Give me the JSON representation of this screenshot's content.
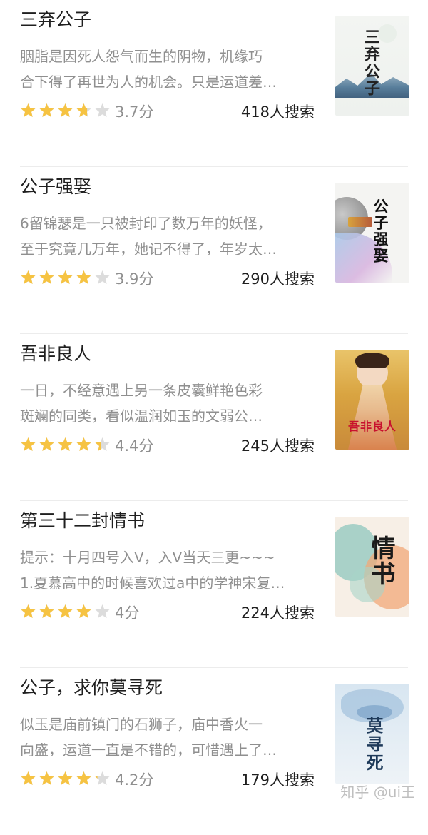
{
  "star_color": "#f6c342",
  "star_empty_color": "#dcdcdc",
  "books": [
    {
      "title": "三弃公子",
      "desc_line1": "胭脂是因死人怨气而生的阴物，机缘巧",
      "desc_line2": "合下得了再世为人的机会。只是运道差…",
      "rating": 3.7,
      "score_text": "3.7分",
      "search_text": "418人搜索",
      "cover_title": "三弃公子",
      "cover_icon": "book-cover-ink-mountains"
    },
    {
      "title": "公子强娶",
      "desc_line1": "6留锦瑟是一只被封印了数万年的妖怪，",
      "desc_line2": "至于究竟几万年，她记不得了，年岁太…",
      "rating": 3.9,
      "score_text": "3.9分",
      "search_text": "290人搜索",
      "cover_title": "公子强娶",
      "cover_icon": "book-cover-moon-waves"
    },
    {
      "title": "吾非良人",
      "desc_line1": "一日，不经意遇上另一条皮囊鲜艳色彩",
      "desc_line2": "斑斓的同类，看似温润如玉的文弱公…",
      "rating": 4.4,
      "score_text": "4.4分",
      "search_text": "245人搜索",
      "cover_title": "吾非良人",
      "cover_icon": "book-cover-lady-portrait"
    },
    {
      "title": "第三十二封情书",
      "desc_line1": "提示：十月四号入V，入V当天三更~~~",
      "desc_line2": "1.夏慕高中的时候喜欢过a中的学神宋复…",
      "rating": 4.0,
      "score_text": "4分",
      "search_text": "224人搜索",
      "cover_title": "情书",
      "cover_icon": "book-cover-watercolor"
    },
    {
      "title": "公子，求你莫寻死",
      "desc_line1": "似玉是庙前镇门的石狮子，庙中香火一",
      "desc_line2": "向盛，运道一直是不错的，可惜遇上了…",
      "rating": 4.2,
      "score_text": "4.2分",
      "search_text": "179人搜索",
      "cover_title": "莫寻死",
      "cover_icon": "book-cover-blue-dragon"
    }
  ],
  "watermark": "知乎 @ui王"
}
